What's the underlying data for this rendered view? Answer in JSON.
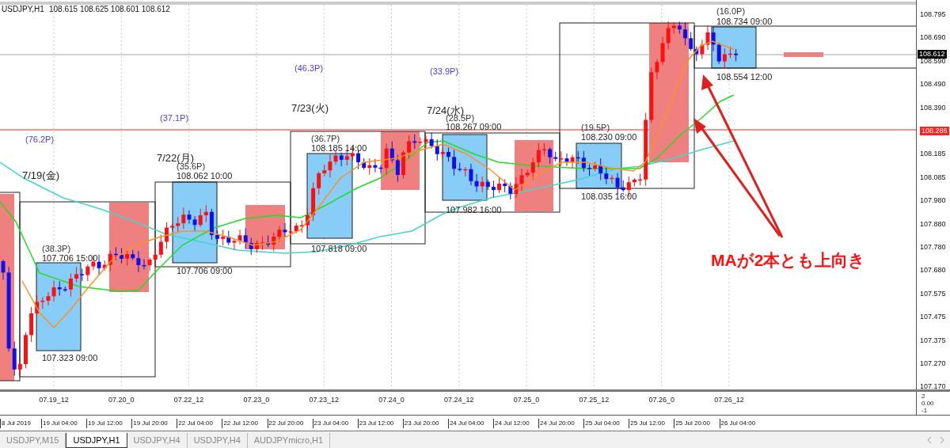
{
  "header": {
    "symbol": "USDJPY,H1",
    "quote": "108.615 108.625 108.601 108.612"
  },
  "annotations": [
    {
      "text": "(76.2P)",
      "kind": "day_range"
    },
    {
      "text": "(37.1P)",
      "kind": "day_range"
    },
    {
      "text": "(46.3P)",
      "kind": "day_range"
    },
    {
      "text": "(33.9P)",
      "kind": "day_range"
    },
    {
      "text": "7/19(金)",
      "kind": "day_label"
    },
    {
      "text": "7/22(月)",
      "kind": "day_label"
    },
    {
      "text": "7/23(火)",
      "kind": "day_label"
    },
    {
      "text": "7/24(水)",
      "kind": "day_label"
    },
    {
      "text": "(38.3P)",
      "kind": "session_range"
    },
    {
      "text": "107.706 15:00",
      "kind": "session_price"
    },
    {
      "text": "107.323 09:00",
      "kind": "session_price"
    },
    {
      "text": "(35.6P)",
      "kind": "session_range"
    },
    {
      "text": "108.062 10:00",
      "kind": "session_price"
    },
    {
      "text": "107.706 09:00",
      "kind": "session_price"
    },
    {
      "text": "(36.7P)",
      "kind": "session_range"
    },
    {
      "text": "108.185 14:00",
      "kind": "session_price"
    },
    {
      "text": "107.818 09:00",
      "kind": "session_price"
    },
    {
      "text": "(28.5P)",
      "kind": "session_range"
    },
    {
      "text": "108.267 09:00",
      "kind": "session_price"
    },
    {
      "text": "107.982 16:00",
      "kind": "session_price"
    },
    {
      "text": "(19.5P)",
      "kind": "session_range"
    },
    {
      "text": "108.230 09:00",
      "kind": "session_price"
    },
    {
      "text": "108.035 16:00",
      "kind": "session_price"
    },
    {
      "text": "(16.0P)",
      "kind": "session_range"
    },
    {
      "text": "108.734 09:00",
      "kind": "session_price"
    },
    {
      "text": "108.554 12:00",
      "kind": "session_price"
    }
  ],
  "callout": {
    "text": "MAが2本とも上向き"
  },
  "price_axis": {
    "labels": [
      "108.795",
      "108.690",
      "108.590",
      "108.490",
      "108.390",
      "108.286",
      "108.185",
      "108.085",
      "107.980",
      "107.880",
      "107.780",
      "107.680",
      "107.575",
      "107.475",
      "107.375",
      "107.270",
      "107.170"
    ],
    "current_price": "108.612"
  },
  "indicator": {
    "time_labels": [
      "07.19_12",
      "07.20_0",
      "07.22_12",
      "07.23_0",
      "07.23_12",
      "07.24_0",
      "07.24_12",
      "07.25_0",
      "07.25_12",
      "07.26_0",
      "07.26_12"
    ],
    "axis_labels": [
      "2",
      "0.00",
      "-1"
    ]
  },
  "time_axis": {
    "labels": [
      "8 Jul 2019",
      "19 Jul 04:00",
      "19 Jul 12:00",
      "19 Jul 20:00",
      "22 Jul 04:00",
      "22 Jul 12:00",
      "22 Jul 20:00",
      "23 Jul 04:00",
      "23 Jul 12:00",
      "23 Jul 20:00",
      "24 Jul 04:00",
      "24 Jul 12:00",
      "24 Jul 20:00",
      "25 Jul 04:00",
      "25 Jul 12:00",
      "25 Jul 20:00",
      "26 Jul 04:00"
    ]
  },
  "tabs": [
    {
      "label": "USDJPY,M15",
      "selected": false
    },
    {
      "label": "USDJPY,H1",
      "selected": true
    },
    {
      "label": "USDJPY,H4",
      "selected": false
    },
    {
      "label": "USDJPY,H4",
      "selected": false
    },
    {
      "label": "AUDJPYmicro,H1",
      "selected": false
    }
  ]
}
